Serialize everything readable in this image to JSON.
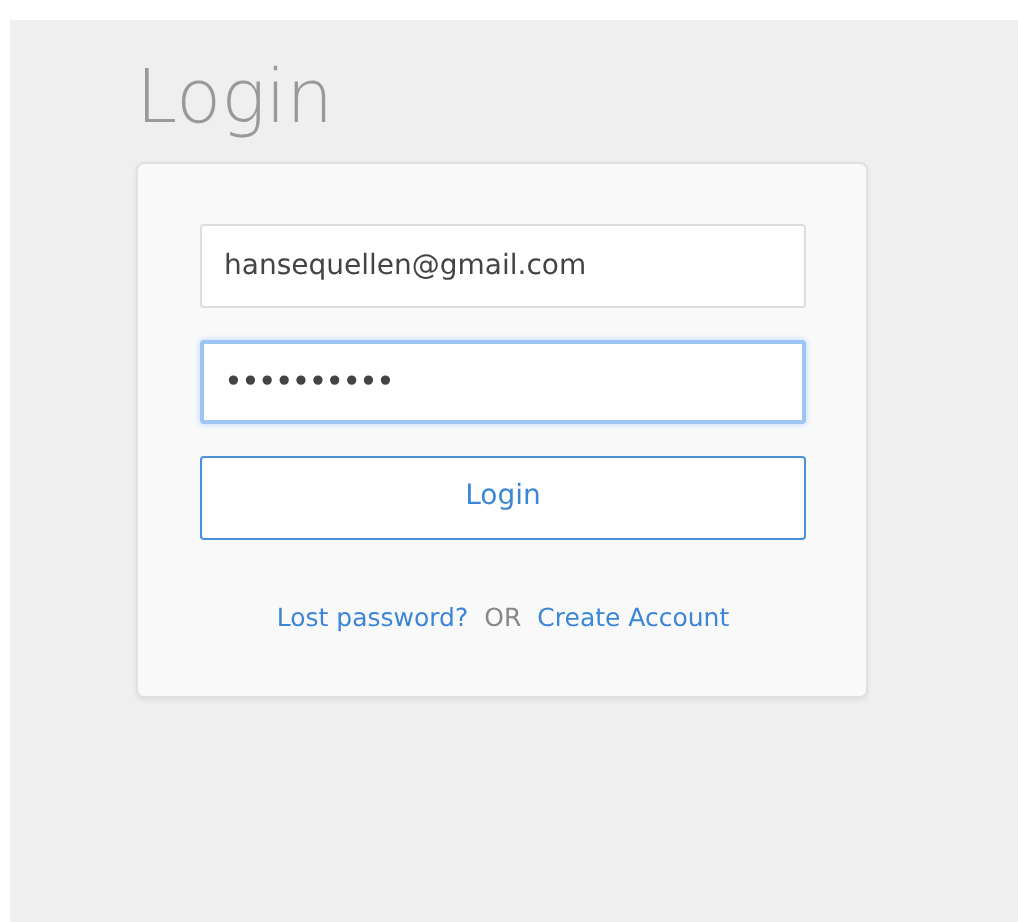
{
  "title": "Login",
  "fields": [
    {
      "kind": "email",
      "value": "hansequellen@gmail.com",
      "focused": false
    },
    {
      "kind": "password",
      "value": "••••••••••",
      "focused": true
    }
  ],
  "submit_button": "Login",
  "links": [
    {
      "kind": "link",
      "text": "Lost password?"
    },
    {
      "kind": "separator",
      "text": "OR"
    },
    {
      "kind": "link",
      "text": "Create Account"
    }
  ]
}
